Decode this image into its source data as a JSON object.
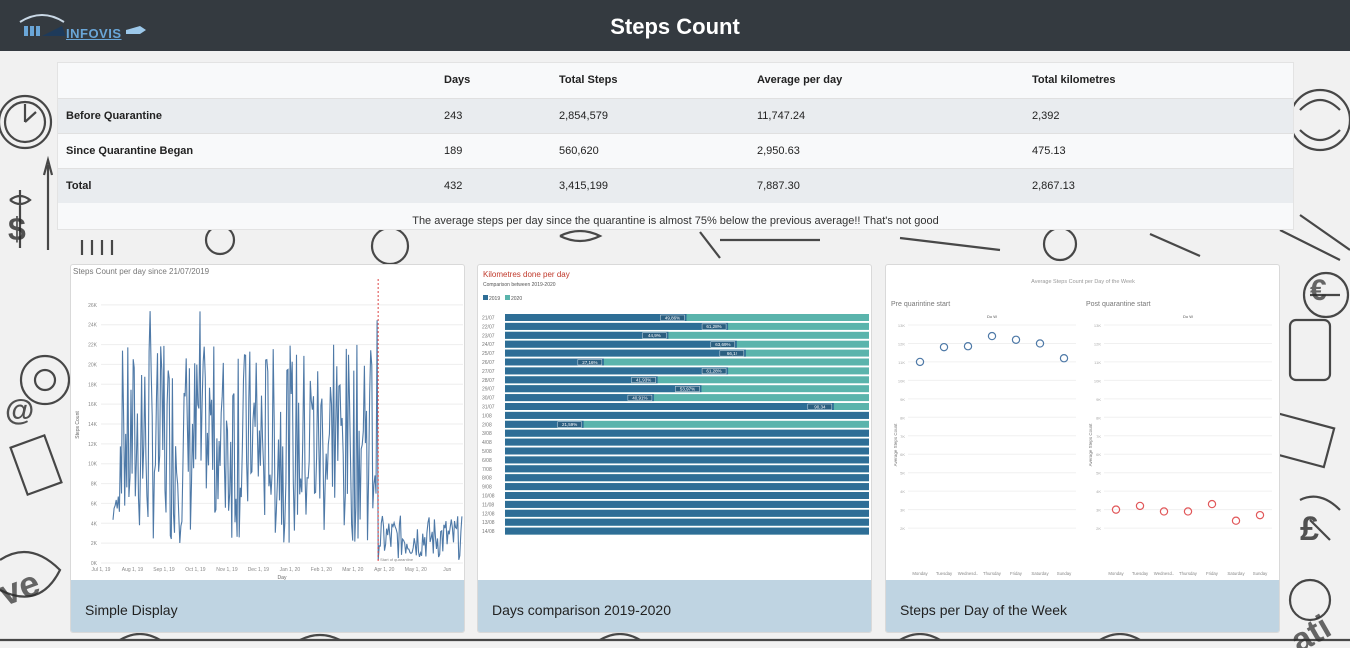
{
  "header": {
    "logo_text": "INFOVIS",
    "title": "Steps Count"
  },
  "stats_table": {
    "columns": [
      "",
      "Days",
      "Total Steps",
      "Average per day",
      "Total kilometres"
    ],
    "rows": [
      {
        "label": "Before Quarantine",
        "days": "243",
        "total_steps": "2,854,579",
        "avg": "11,747.24",
        "km": "2,392"
      },
      {
        "label": "Since Quarantine Began",
        "days": "189",
        "total_steps": "560,620",
        "avg": "2,950.63",
        "km": "475.13"
      },
      {
        "label": "Total",
        "days": "432",
        "total_steps": "3,415,199",
        "avg": "7,887.30",
        "km": "2,867.13"
      }
    ],
    "note": "The average steps per day since the quarantine is almost 75% below the previous average!! That's not good"
  },
  "cards": [
    {
      "caption": "Simple Display"
    },
    {
      "caption": "Days comparison 2019-2020"
    },
    {
      "caption": "Steps per Day of the Week"
    }
  ],
  "colors": {
    "header_bg": "#343a40",
    "line": "#4e79a7",
    "bar_2019": "#2e6e96",
    "bar_2020": "#5ab4ac",
    "post_marker": "#e15759",
    "caption_bg": "#bfd4e2"
  },
  "chart_data": [
    {
      "type": "line",
      "title": "Steps Count per day since 21/07/2019",
      "ylabel": "Steps Count",
      "xlabel": "Day",
      "ylim": [
        0,
        28000
      ],
      "y_ticks": [
        "0K",
        "2K",
        "4K",
        "6K",
        "8K",
        "10K",
        "12K",
        "14K",
        "16K",
        "18K",
        "20K",
        "22K",
        "24K",
        "26K"
      ],
      "x_ticks": [
        "Jul 1, 19",
        "Aug 1, 19",
        "Sep 1, 19",
        "Oct 1, 19",
        "Nov 1, 19",
        "Dec 1, 19",
        "Jan 1, 20",
        "Feb 1, 20",
        "Mar 1, 20",
        "Apr 1, 20",
        "May 1, 20",
        "Jun"
      ],
      "marker_label": "Start of quarantine",
      "grid": true
    },
    {
      "type": "bar",
      "orientation": "horizontal-stacked-percent",
      "title": "Kilometres done per day",
      "subtitle": "Comparison between 2019-2020",
      "legend": [
        "2019",
        "2020"
      ],
      "categories": [
        "21/07",
        "22/07",
        "23/07",
        "24/07",
        "25/07",
        "26/07",
        "27/07",
        "28/07",
        "29/07",
        "30/07",
        "31/07",
        "1/08",
        "2/08",
        "3/08",
        "4/08",
        "5/08",
        "6/08",
        "7/08",
        "8/08",
        "9/08",
        "10/08",
        "11/08",
        "12/08",
        "13/08",
        "14/08"
      ],
      "series": [
        {
          "name": "2019",
          "values": [
            49.86,
            61.28,
            44.9,
            63.69,
            66.17,
            27.16,
            61.28,
            41.93,
            53.97,
            40.91,
            90.34,
            100,
            21.59,
            100,
            100,
            100,
            100,
            100,
            100,
            100,
            100,
            100,
            100,
            100,
            100
          ]
        }
      ],
      "labels": [
        "49,86%",
        "61,28%",
        "44,9%",
        "63,69%",
        "66,1!",
        "27,16%",
        "61,28%",
        "41,93%",
        "53,97%",
        "40,91%",
        "90,34",
        "",
        "21,59%",
        "",
        "",
        "",
        "",
        "",
        "",
        "",
        "",
        "",
        "",
        "",
        ""
      ]
    },
    {
      "type": "scatter",
      "title": "Average Steps Count per Day of the Week",
      "panels": [
        {
          "name": "Pre quarintine start",
          "sublabel": "Do W",
          "categories": [
            "Monday",
            "Tuesday",
            "Wednesd..",
            "Thursday",
            "Friday",
            "Saturday",
            "Sunday"
          ],
          "values": [
            11000,
            11800,
            11850,
            12400,
            12200,
            12000,
            11200
          ]
        },
        {
          "name": "Post quarantine start",
          "sublabel": "Do W",
          "categories": [
            "Monday",
            "Tuesday",
            "Wednesd..",
            "Thursday",
            "Friday",
            "Saturday",
            "Sunday"
          ],
          "values": [
            3000,
            3200,
            2900,
            2900,
            3300,
            2400,
            2700
          ]
        }
      ],
      "ylabel": "Average Steps Count",
      "ylim": [
        0,
        13000
      ],
      "y_ticks": [
        "2K",
        "3K",
        "4K",
        "5K",
        "6K",
        "7K",
        "8K",
        "9K",
        "10K",
        "11K",
        "12K",
        "13K"
      ]
    }
  ]
}
